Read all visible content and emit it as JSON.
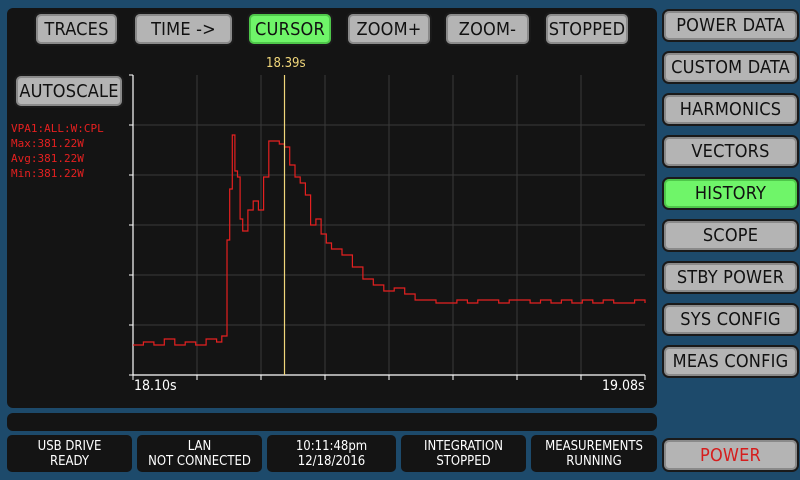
{
  "toolbar": {
    "traces": "TRACES",
    "time": "TIME ->",
    "cursor": "CURSOR",
    "zoom_in": "ZOOM+",
    "zoom_out": "ZOOM-",
    "stopped": "STOPPED",
    "autoscale": "AUTOSCALE"
  },
  "sidebar": {
    "items": [
      {
        "label": "POWER DATA"
      },
      {
        "label": "CUSTOM DATA"
      },
      {
        "label": "HARMONICS"
      },
      {
        "label": "VECTORS"
      },
      {
        "label": "HISTORY"
      },
      {
        "label": "SCOPE"
      },
      {
        "label": "STBY POWER"
      },
      {
        "label": "SYS CONFIG"
      },
      {
        "label": "MEAS CONFIG"
      }
    ],
    "active": "HISTORY",
    "power": "POWER"
  },
  "trace_info": {
    "channel": "VPA1:ALL:W:CPL",
    "max": "Max:381.22W",
    "avg": "Avg:381.22W",
    "min": "Min:381.22W"
  },
  "cursor_label": "18.39s",
  "status": {
    "usb": {
      "line1": "USB DRIVE",
      "line2": "READY"
    },
    "lan": {
      "line1": "LAN",
      "line2": "NOT CONNECTED"
    },
    "clock": {
      "line1": "10:11:48pm",
      "line2": "12/18/2016"
    },
    "integration": {
      "line1": "INTEGRATION",
      "line2": "STOPPED"
    },
    "measurements": {
      "line1": "MEASUREMENTS",
      "line2": "RUNNING"
    }
  },
  "colors": {
    "background": "#1d4a6b",
    "panel": "#141414",
    "button": "#b4b4b4",
    "active_button": "#6ff569",
    "trace": "#e52020",
    "cursor": "#f0d67a",
    "power_text": "#d61d1d"
  },
  "chart_data": {
    "type": "line",
    "x_range": [
      "18.10s",
      "19.08s"
    ],
    "xlim": [
      18.1,
      19.08
    ],
    "ylim": [
      0,
      1
    ],
    "cursor_x": 18.39,
    "grid": true,
    "series": [
      {
        "x": [
          18.1,
          18.12,
          18.14,
          18.16,
          18.18,
          18.2,
          18.22,
          18.24,
          18.26,
          18.27,
          18.28,
          18.285,
          18.29,
          18.295,
          18.3,
          18.305,
          18.31,
          18.32,
          18.33,
          18.34,
          18.35,
          18.36,
          18.37,
          18.38,
          18.39,
          18.4,
          18.41,
          18.42,
          18.43,
          18.44,
          18.45,
          18.46,
          18.47,
          18.48,
          18.5,
          18.52,
          18.54,
          18.56,
          18.58,
          18.6,
          18.62,
          18.64,
          18.66,
          18.68,
          18.7,
          18.72,
          18.74,
          18.76,
          18.78,
          18.8,
          18.82,
          18.84,
          18.86,
          18.88,
          18.9,
          18.92,
          18.94,
          18.96,
          18.98,
          19.0,
          19.02,
          19.04,
          19.06,
          19.08
        ],
        "y": [
          0.1,
          0.11,
          0.1,
          0.12,
          0.1,
          0.11,
          0.1,
          0.12,
          0.11,
          0.13,
          0.45,
          0.62,
          0.8,
          0.68,
          0.66,
          0.52,
          0.48,
          0.55,
          0.58,
          0.55,
          0.66,
          0.78,
          0.78,
          0.77,
          0.76,
          0.7,
          0.66,
          0.64,
          0.6,
          0.5,
          0.52,
          0.47,
          0.44,
          0.42,
          0.4,
          0.36,
          0.32,
          0.3,
          0.28,
          0.29,
          0.27,
          0.25,
          0.25,
          0.24,
          0.24,
          0.25,
          0.24,
          0.25,
          0.25,
          0.24,
          0.25,
          0.25,
          0.24,
          0.25,
          0.24,
          0.25,
          0.24,
          0.25,
          0.24,
          0.25,
          0.24,
          0.24,
          0.25,
          0.24
        ]
      }
    ]
  }
}
